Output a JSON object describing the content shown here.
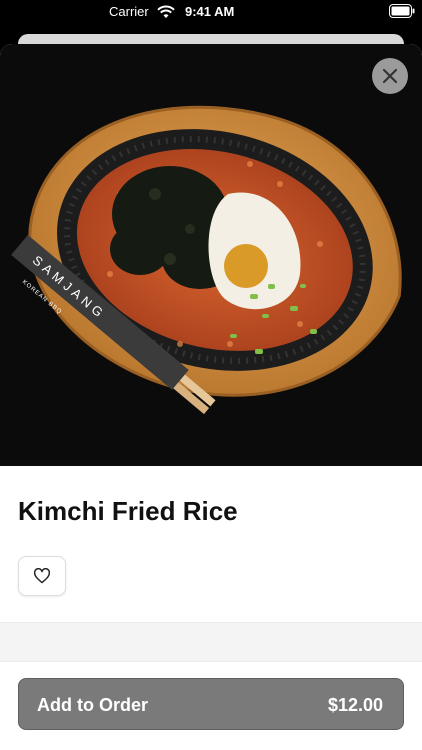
{
  "status_bar": {
    "carrier": "Carrier",
    "time": "9:41 AM"
  },
  "item": {
    "title": "Kimchi Fried Rice",
    "image_icon": "kimchi-fried-rice-photo",
    "chopstick_brand": "SAMJANG",
    "chopstick_tagline": "KOREAN BBQ"
  },
  "actions": {
    "close_icon": "close-icon",
    "favorite_icon": "heart-icon",
    "add_label": "Add to Order",
    "price": "$12.00"
  },
  "colors": {
    "button_bg": "#7a7a7a",
    "close_bg": "#9b9b9b",
    "plate_wood": "#c9893a",
    "skillet": "#1c1c1c",
    "rice": "#c8562a"
  }
}
